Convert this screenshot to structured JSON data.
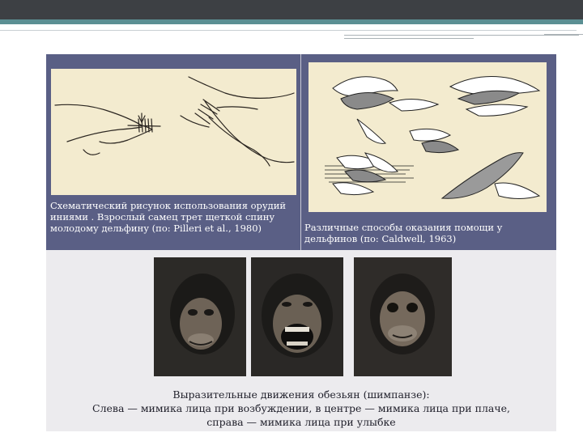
{
  "slide": {
    "left_caption": "Схематический рисунок использования орудий иниями . Взрослый самец трет щеткой спину молодому дельфину (по: Pilleri et al., 1980)",
    "right_caption": "Различные способы оказания помощи у дельфинов (по: Caldwell, 1963)",
    "bottom_caption_line1": "Выразительные движения обезьян (шимпанзе):",
    "bottom_caption_line2": "Слева — мимика лица при возбуждении, в центре — мимика лица при плаче,",
    "bottom_caption_line3": "справа — мимика лица при улыбке"
  },
  "colors": {
    "panel": "#5a5f85",
    "drawing_bg": "#f3ebcf",
    "lower_bg": "#ecebee",
    "topbar": "#3d4044",
    "accent_strip": "#5b8f93"
  },
  "images": {
    "left": "dolphin-tool-sketch",
    "right": "dolphins-helping-illustration",
    "photos": [
      "chimp-excited",
      "chimp-crying",
      "chimp-smiling"
    ]
  }
}
